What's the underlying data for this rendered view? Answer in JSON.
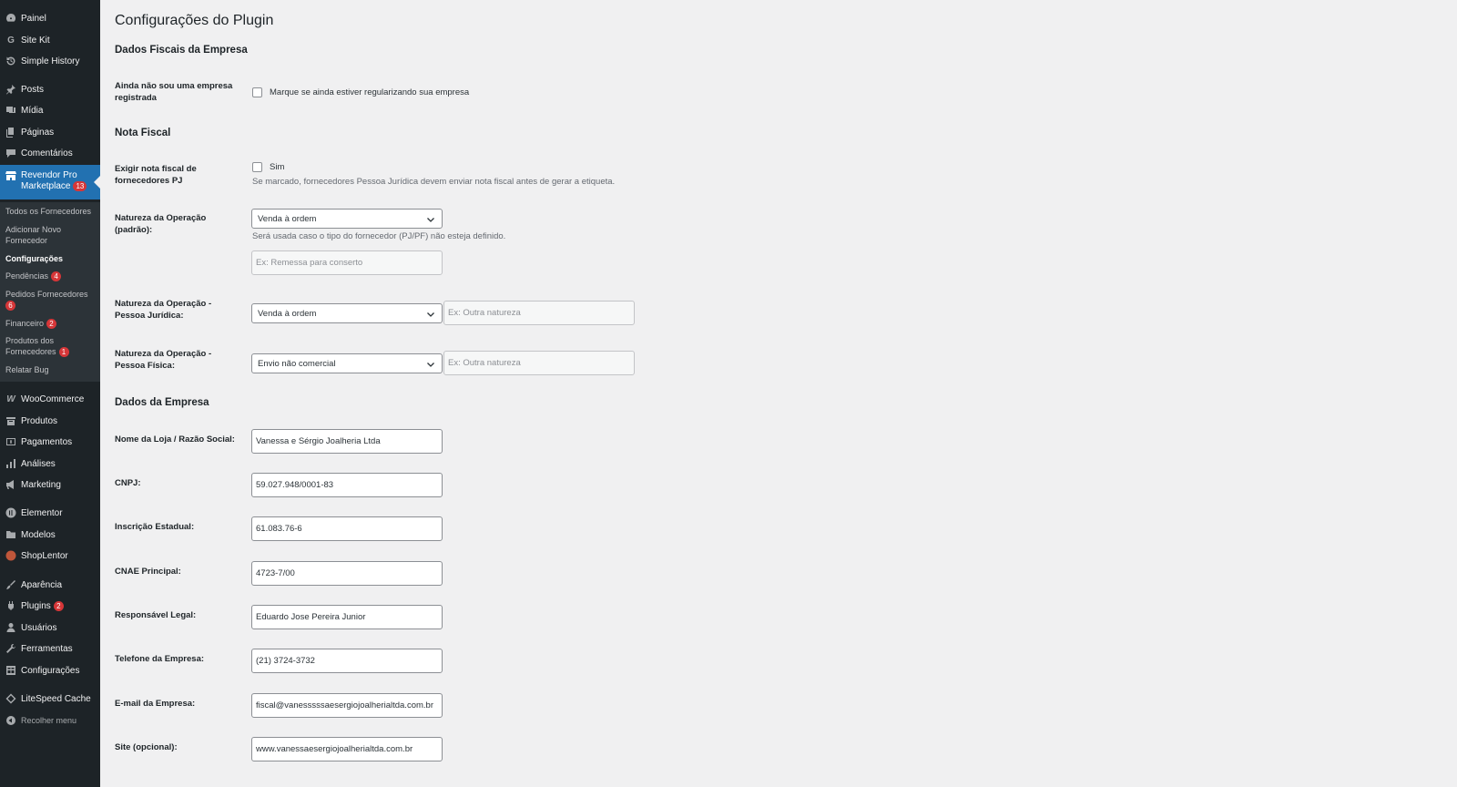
{
  "sidebar": {
    "menu": [
      {
        "label": "Painel",
        "icon": "dashboard-icon"
      },
      {
        "label": "Site Kit",
        "icon": "site-kit-icon"
      },
      {
        "label": "Simple History",
        "icon": "history-icon"
      },
      {
        "label": "Posts",
        "icon": "pin-icon"
      },
      {
        "label": "Mídia",
        "icon": "media-icon"
      },
      {
        "label": "Páginas",
        "icon": "pages-icon"
      },
      {
        "label": "Comentários",
        "icon": "comments-icon"
      },
      {
        "label": "Revendor Pro Marketplace",
        "icon": "store-icon",
        "badge": "13"
      },
      {
        "label": "WooCommerce",
        "icon": "woocommerce-icon"
      },
      {
        "label": "Produtos",
        "icon": "products-icon"
      },
      {
        "label": "Pagamentos",
        "icon": "payments-icon"
      },
      {
        "label": "Análises",
        "icon": "analytics-icon"
      },
      {
        "label": "Marketing",
        "icon": "megaphone-icon"
      },
      {
        "label": "Elementor",
        "icon": "elementor-icon"
      },
      {
        "label": "Modelos",
        "icon": "folder-icon"
      },
      {
        "label": "ShopLentor",
        "icon": "shoplentor-icon"
      },
      {
        "label": "Aparência",
        "icon": "brush-icon"
      },
      {
        "label": "Plugins",
        "icon": "plugin-icon",
        "badge": "2"
      },
      {
        "label": "Usuários",
        "icon": "users-icon"
      },
      {
        "label": "Ferramentas",
        "icon": "wrench-icon"
      },
      {
        "label": "Configurações",
        "icon": "settings-icon"
      },
      {
        "label": "LiteSpeed Cache",
        "icon": "litespeed-icon"
      },
      {
        "label": "Recolher menu",
        "icon": "collapse-icon"
      }
    ],
    "submenu": [
      {
        "label": "Todos os Fornecedores"
      },
      {
        "label": "Adicionar Novo Fornecedor"
      },
      {
        "label": "Configurações"
      },
      {
        "label": "Pendências",
        "badge": "4"
      },
      {
        "label": "Pedidos Fornecedores",
        "badge": "6"
      },
      {
        "label": "Financeiro",
        "badge": "2"
      },
      {
        "label": "Produtos dos Fornecedores",
        "badge": "1"
      },
      {
        "label": "Relatar Bug"
      }
    ]
  },
  "page": {
    "title": "Configurações do Plugin",
    "section_fiscal": "Dados Fiscais da Empresa",
    "section_nota": "Nota Fiscal",
    "section_empresa": "Dados da Empresa"
  },
  "fiscal": {
    "not_registered_label": "Ainda não sou uma empresa registrada",
    "not_registered_checkbox": "Marque se ainda estiver regularizando sua empresa"
  },
  "nota": {
    "require_label": "Exigir nota fiscal de fornecedores PJ",
    "require_checkbox": "Sim",
    "require_desc": "Se marcado, fornecedores Pessoa Jurídica devem enviar nota fiscal antes de gerar a etiqueta.",
    "natureza_default_label": "Natureza da Operação (padrão):",
    "natureza_default_value": "Venda à ordem",
    "natureza_default_desc": "Será usada caso o tipo do fornecedor (PJ/PF) não esteja definido.",
    "natureza_default_placeholder": "Ex: Remessa para conserto",
    "natureza_pj_label": "Natureza da Operação - Pessoa Jurídica:",
    "natureza_pj_value": "Venda à ordem",
    "natureza_pj_placeholder": "Ex: Outra natureza",
    "natureza_pf_label": "Natureza da Operação - Pessoa Física:",
    "natureza_pf_value": "Envio não comercial",
    "natureza_pf_placeholder": "Ex: Outra natureza"
  },
  "empresa": {
    "fields": [
      {
        "label": "Nome da Loja / Razão Social:",
        "value": "Vanessa e Sérgio Joalheria Ltda"
      },
      {
        "label": "CNPJ:",
        "value": "59.027.948/0001-83"
      },
      {
        "label": "Inscrição Estadual:",
        "value": "61.083.76-6"
      },
      {
        "label": "CNAE Principal:",
        "value": "4723-7/00"
      },
      {
        "label": "Responsável Legal:",
        "value": "Eduardo Jose Pereira Junior"
      },
      {
        "label": "Telefone da Empresa:",
        "value": "(21) 3724-3732"
      },
      {
        "label": "E-mail da Empresa:",
        "value": "fiscal@vanesssssaesergiojoalherialtda.com.br"
      },
      {
        "label": "Site (opcional):",
        "value": "www.vanessaesergiojoalherialtda.com.br"
      }
    ]
  },
  "colors": {
    "sidebar_bg": "#1d2327",
    "submenu_bg": "#2c3338",
    "active_bg": "#2271b1",
    "badge_bg": "#d63638",
    "page_bg": "#f0f0f1"
  }
}
